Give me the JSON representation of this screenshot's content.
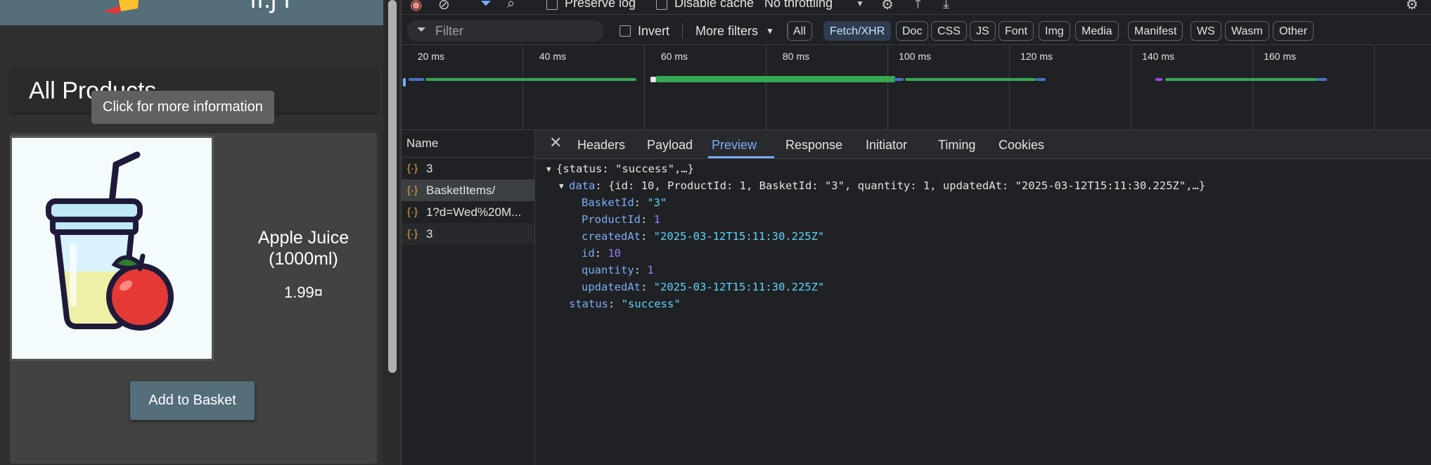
{
  "app": {
    "page_heading": "All Products",
    "tooltip": "Click for more information",
    "product": {
      "name": "Apple Juice\n(1000ml)",
      "price": "1.99¤"
    },
    "add_button": "Add to Basket"
  },
  "devtools": {
    "toolbar": {
      "preserve_log": "Preserve log",
      "disable_cache": "Disable cache",
      "throttling": "No throttling"
    },
    "filter": {
      "placeholder": "Filter",
      "invert": "Invert",
      "more_filters": "More filters",
      "types": [
        "All",
        "Fetch/XHR",
        "Doc",
        "CSS",
        "JS",
        "Font",
        "Img",
        "Media",
        "Manifest",
        "WS",
        "Wasm",
        "Other"
      ],
      "active_type": "Fetch/XHR"
    },
    "timeline": {
      "ticks": [
        "20 ms",
        "40 ms",
        "60 ms",
        "80 ms",
        "100 ms",
        "120 ms",
        "140 ms",
        "160 ms"
      ]
    },
    "requests": {
      "header": "Name",
      "rows": [
        "3",
        "BasketItems/",
        "1?d=Wed%20M...",
        "3"
      ]
    },
    "detail": {
      "tabs": [
        "Headers",
        "Payload",
        "Preview",
        "Response",
        "Initiator",
        "Timing",
        "Cookies"
      ],
      "active_tab": "Preview",
      "preview": {
        "root_summary": "{status: \"success\",…}",
        "data_key": "data",
        "data_summary": "{id: 10, ProductId: 1, BasketId: \"3\", quantity: 1, updatedAt: \"2025-03-12T15:11:30.225Z\",…}",
        "fields": [
          {
            "key": "BasketId",
            "value": "\"3\"",
            "type": "string"
          },
          {
            "key": "ProductId",
            "value": "1",
            "type": "number"
          },
          {
            "key": "createdAt",
            "value": "\"2025-03-12T15:11:30.225Z\"",
            "type": "string"
          },
          {
            "key": "id",
            "value": "10",
            "type": "number"
          },
          {
            "key": "quantity",
            "value": "1",
            "type": "number"
          },
          {
            "key": "updatedAt",
            "value": "\"2025-03-12T15:11:30.225Z\"",
            "type": "string"
          }
        ],
        "status_key": "status",
        "status_value": "\"success\""
      }
    },
    "colors": {
      "accent": "#7cacf8",
      "string": "#5cd5fb",
      "number": "#9980ff",
      "bar": "#34a853"
    }
  }
}
